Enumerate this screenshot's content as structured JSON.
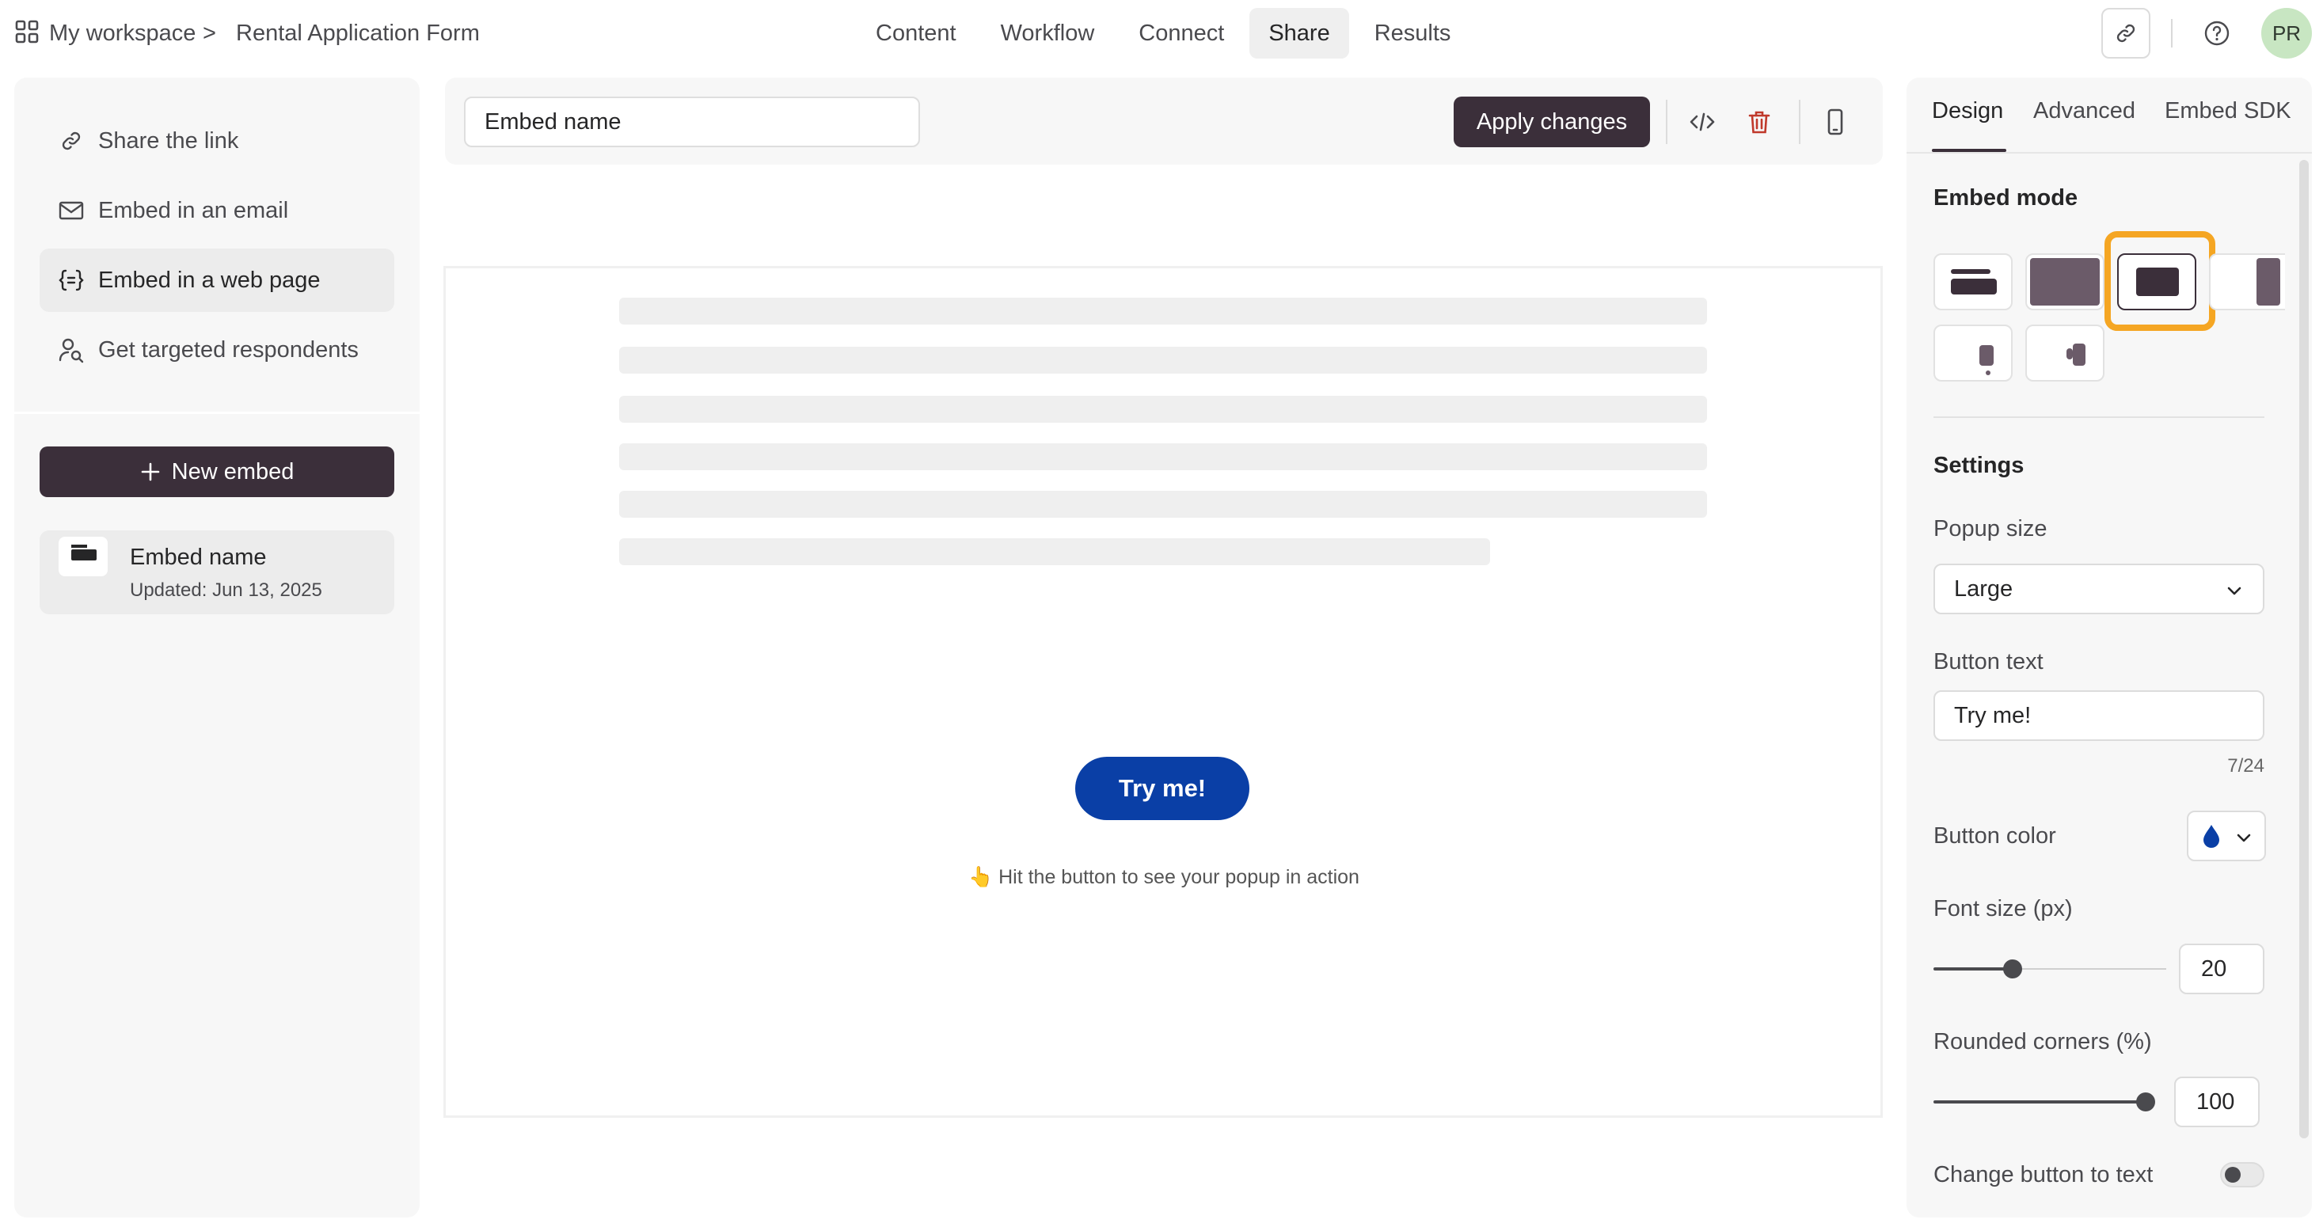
{
  "breadcrumb": {
    "workspace": "My workspace",
    "separator": ">",
    "form": "Rental Application Form"
  },
  "nav": {
    "tabs": [
      {
        "label": "Content",
        "active": false
      },
      {
        "label": "Workflow",
        "active": false
      },
      {
        "label": "Connect",
        "active": false
      },
      {
        "label": "Share",
        "active": true
      },
      {
        "label": "Results",
        "active": false
      }
    ]
  },
  "user": {
    "initials": "PR"
  },
  "share_options": [
    {
      "label": "Share the link",
      "icon": "link-icon",
      "active": false
    },
    {
      "label": "Embed in an email",
      "icon": "mail-icon",
      "active": false
    },
    {
      "label": "Embed in a web page",
      "icon": "code-braces-icon",
      "active": true
    },
    {
      "label": "Get targeted respondents",
      "icon": "person-search-icon",
      "active": false
    }
  ],
  "new_embed_label": "New embed",
  "embed_card": {
    "title": "Embed name",
    "updated": "Updated: Jun 13, 2025"
  },
  "toolbar": {
    "embed_name_value": "Embed name",
    "apply_label": "Apply changes"
  },
  "preview": {
    "button_label": "Try me!",
    "hint": "👆 Hit the button to see your popup in action"
  },
  "design_panel": {
    "tabs": [
      {
        "label": "Design",
        "active": true
      },
      {
        "label": "Advanced",
        "active": false
      },
      {
        "label": "Embed SDK",
        "active": false
      }
    ],
    "embed_mode_title": "Embed mode",
    "selected_mode": "popup",
    "settings_title": "Settings",
    "popup_size_label": "Popup size",
    "popup_size_value": "Large",
    "button_text_label": "Button text",
    "button_text_value": "Try me!",
    "button_text_counter": "7/24",
    "button_color_label": "Button color",
    "button_color": "#0a3fa6",
    "font_size_label": "Font size (px)",
    "font_size_value": "20",
    "font_size_level": 0.25,
    "rounded_corners_label": "Rounded corners (%)",
    "rounded_corners_value": "100",
    "rounded_corners_level": 1.0,
    "change_button_to_text_label": "Change button to text",
    "change_button_to_text_on": false
  },
  "colors": {
    "primary_dark": "#3b2f3a",
    "accent_highlight": "#f5a623",
    "try_button": "#0a3fa6",
    "avatar_bg": "#c8e6c2",
    "delete_red": "#c0392b"
  }
}
